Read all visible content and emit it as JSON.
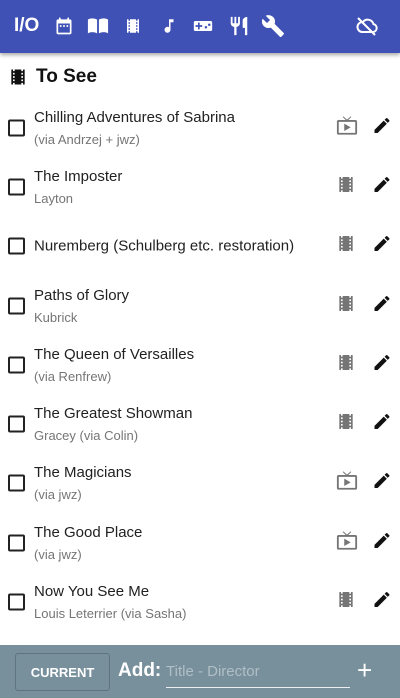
{
  "topbar": {
    "io_label": "I/O",
    "icons": [
      "calendar-icon",
      "book-icon",
      "film-icon",
      "music-icon",
      "gamepad-icon",
      "restaurant-icon",
      "wrench-icon"
    ],
    "cloud_status_icon": "cloud-off-icon"
  },
  "heading": {
    "title": "To See",
    "icon": "film-icon"
  },
  "items": [
    {
      "title": "Chilling Adventures of Sabrina",
      "subtitle": "(via Andrzej + jwz)",
      "type": "tv"
    },
    {
      "title": "The Imposter",
      "subtitle": "Layton",
      "type": "film"
    },
    {
      "title": "Nuremberg (Schulberg etc. restoration)",
      "subtitle": "",
      "type": "film"
    },
    {
      "title": "Paths of Glory",
      "subtitle": "Kubrick",
      "type": "film"
    },
    {
      "title": "The Queen of Versailles",
      "subtitle": "(via Renfrew)",
      "type": "film"
    },
    {
      "title": "The Greatest Showman",
      "subtitle": "Gracey (via Colin)",
      "type": "film"
    },
    {
      "title": "The Magicians",
      "subtitle": "(via jwz)",
      "type": "tv"
    },
    {
      "title": "The Good Place",
      "subtitle": "(via jwz)",
      "type": "tv"
    },
    {
      "title": "Now You See Me",
      "subtitle": "Louis Leterrier (via Sasha)",
      "type": "film"
    },
    {
      "title": "Akira",
      "subtitle": "",
      "type": "film"
    }
  ],
  "bottom": {
    "current_label": "CURRENT",
    "add_label": "Add:",
    "input_value": "",
    "input_placeholder": "Title - Director",
    "add_button": "+"
  }
}
